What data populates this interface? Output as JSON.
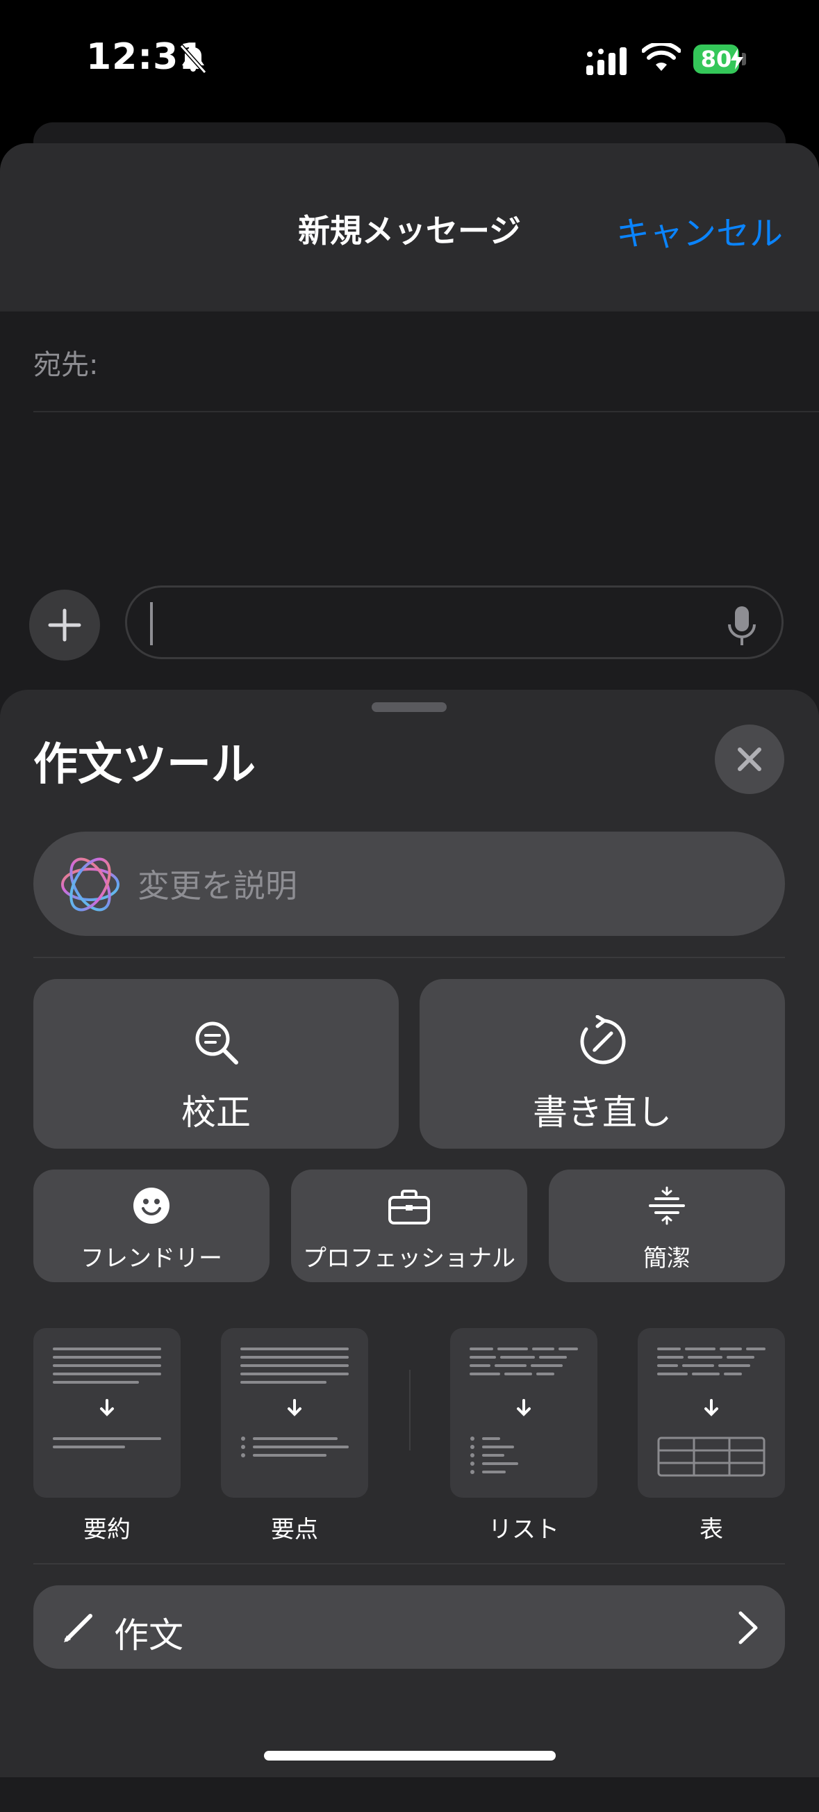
{
  "status_bar": {
    "time": "12:31",
    "battery": "80"
  },
  "compose": {
    "title": "新規メッセージ",
    "cancel_label": "キャンセル",
    "to_label": "宛先:"
  },
  "writing_tools": {
    "title": "作文ツール",
    "describe_placeholder": "変更を説明",
    "proofread_label": "校正",
    "rewrite_label": "書き直し",
    "friendly_label": "フレンドリー",
    "professional_label": "プロフェッショナル",
    "concise_label": "簡潔",
    "summary_label": "要約",
    "key_points_label": "要点",
    "list_label": "リスト",
    "table_label": "表",
    "compose_label": "作文"
  },
  "colors": {
    "accent": "#0a84ff",
    "battery": "#34c759"
  }
}
